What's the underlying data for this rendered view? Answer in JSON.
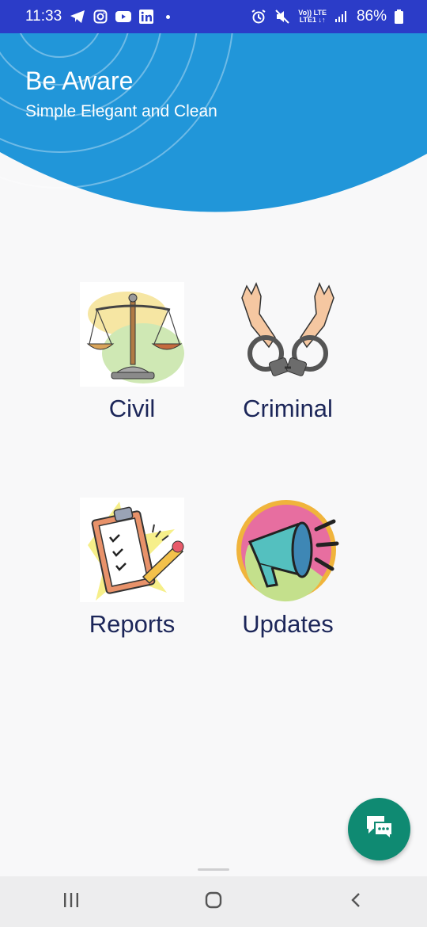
{
  "status_bar": {
    "time": "11:33",
    "network_top": "Vo)) LTE",
    "network_bottom": "LTE1 ↓↑",
    "battery": "86%"
  },
  "header": {
    "title": "Be Aware",
    "subtitle": "Simple Elegant and Clean",
    "color": "#2196d9"
  },
  "tiles": [
    {
      "label": "Civil",
      "icon": "scales-of-justice-icon"
    },
    {
      "label": "Criminal",
      "icon": "handcuffs-icon"
    },
    {
      "label": "Reports",
      "icon": "clipboard-icon"
    },
    {
      "label": "Updates",
      "icon": "megaphone-icon"
    }
  ],
  "fab": {
    "icon": "chat-icon",
    "color": "#0f8a72"
  },
  "nav": {
    "recents": "recents-icon",
    "home": "home-icon",
    "back": "back-icon"
  }
}
